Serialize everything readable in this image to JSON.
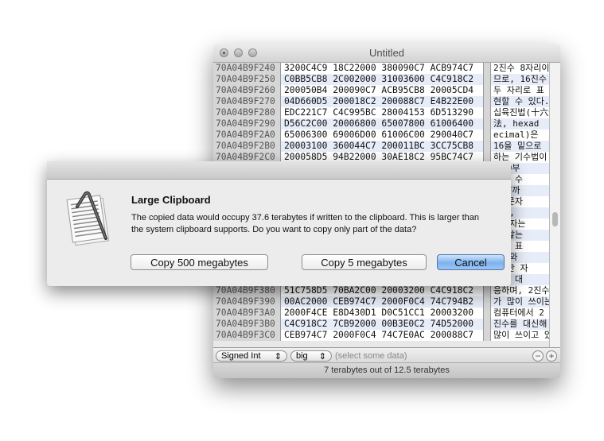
{
  "window": {
    "title": "Untitled"
  },
  "rows": [
    {
      "addr": "70A04B9F240",
      "hex": "3200C4C9 18C22000 380090C7 ACB974C7",
      "text": "2진수 8자리이"
    },
    {
      "addr": "70A04B9F250",
      "hex": "C0BB5CB8 2C002000 31003600 C4C918C2",
      "text": "므로, 16진수"
    },
    {
      "addr": "70A04B9F260",
      "hex": "200050B4 200090C7 ACB95CB8 20005CD4",
      "text": " 두 자리로 표"
    },
    {
      "addr": "70A04B9F270",
      "hex": "04D660D5 200018C2 200088C7 E4B22E00",
      "text": "현할 수 있다."
    },
    {
      "addr": "70A04B9F280",
      "hex": "EDC221C7 C4C995BC 28004153 6D513290",
      "text": "십육진법(十六進"
    },
    {
      "addr": "70A04B9F290",
      "hex": "D56C2C00 20006800 65007800 61006400",
      "text": "法, hexad"
    },
    {
      "addr": "70A04B9F2A0",
      "hex": "65006300 69006D00 61006C00 290040C7",
      "text": "ecimal)은"
    },
    {
      "addr": "70A04B9F2B0",
      "hex": "20003100 360044C7 200011BC 3CC75CB8",
      "text": " 16을 밑으로"
    },
    {
      "addr": "70A04B9F2C0",
      "hex": "200058D5 94B22000 30AE18C2 95BC74C7",
      "text": " 하는 기수법이"
    },
    {
      "addr": "",
      "hex": "",
      "text": "통 0부"
    },
    {
      "addr": "",
      "hex": "",
      "text": "지의 수"
    },
    {
      "addr": "",
      "hex": "",
      "text": "서 F까"
    },
    {
      "addr": "",
      "hex": "",
      "text": "마 문자"
    },
    {
      "addr": "",
      "hex": "",
      "text": "했고,"
    },
    {
      "addr": "",
      "hex": "",
      "text": "소문자는"
    },
    {
      "addr": "",
      "hex": "",
      "text": "지 않는"
    },
    {
      "addr": "",
      "hex": "",
      "text": "진법 표"
    },
    {
      "addr": "",
      "hex": "",
      "text": "자리와"
    },
    {
      "addr": "",
      "hex": "",
      "text": "의 한 자"
    },
    {
      "addr": "",
      "hex": "",
      "text": "내일 대"
    },
    {
      "addr": "70A04B9F380",
      "hex": "51C758D5 70BA2C00 20003200 C4C918C2",
      "text": "응하며, 2진수"
    },
    {
      "addr": "70A04B9F390",
      "hex": "00AC2000 CEB974C7 2000F0C4 74C794B2",
      "text": "가 많이 쓰이는"
    },
    {
      "addr": "70A04B9F3A0",
      "hex": "2000F4CE E8D430D1 D0C51CC1 20003200",
      "text": " 컴퓨터에서 2"
    },
    {
      "addr": "70A04B9F3B0",
      "hex": "C4C918C2 7CB92000 00B3E0C2 74D52000",
      "text": "진수를 대신해"
    },
    {
      "addr": "70A04B9F3C0",
      "hex": "CEB974C7 2000F0C4 74C7E0AC 200088C7",
      "text": "많이 쓰이고 있"
    }
  ],
  "bottombar": {
    "type_select": "Signed Int",
    "endian_select": "big",
    "hint": "(select some data)",
    "minus": "−",
    "plus": "+"
  },
  "status": "7 terabytes out of 12.5 terabytes",
  "dialog": {
    "icon": "hexfiend-clipboard-icon",
    "title": "Large Clipboard",
    "message": "The copied data would occupy 37.6 terabytes if written to the clipboard.  This is larger than the system clipboard supports.  Do you want to copy only part of the data?",
    "buttons": {
      "copy_500": "Copy 500 megabytes",
      "copy_5": "Copy 5 megabytes",
      "cancel": "Cancel"
    }
  },
  "colors": {
    "default_button": "#7fb2ee",
    "row_stripe": "#e6ecf8"
  }
}
